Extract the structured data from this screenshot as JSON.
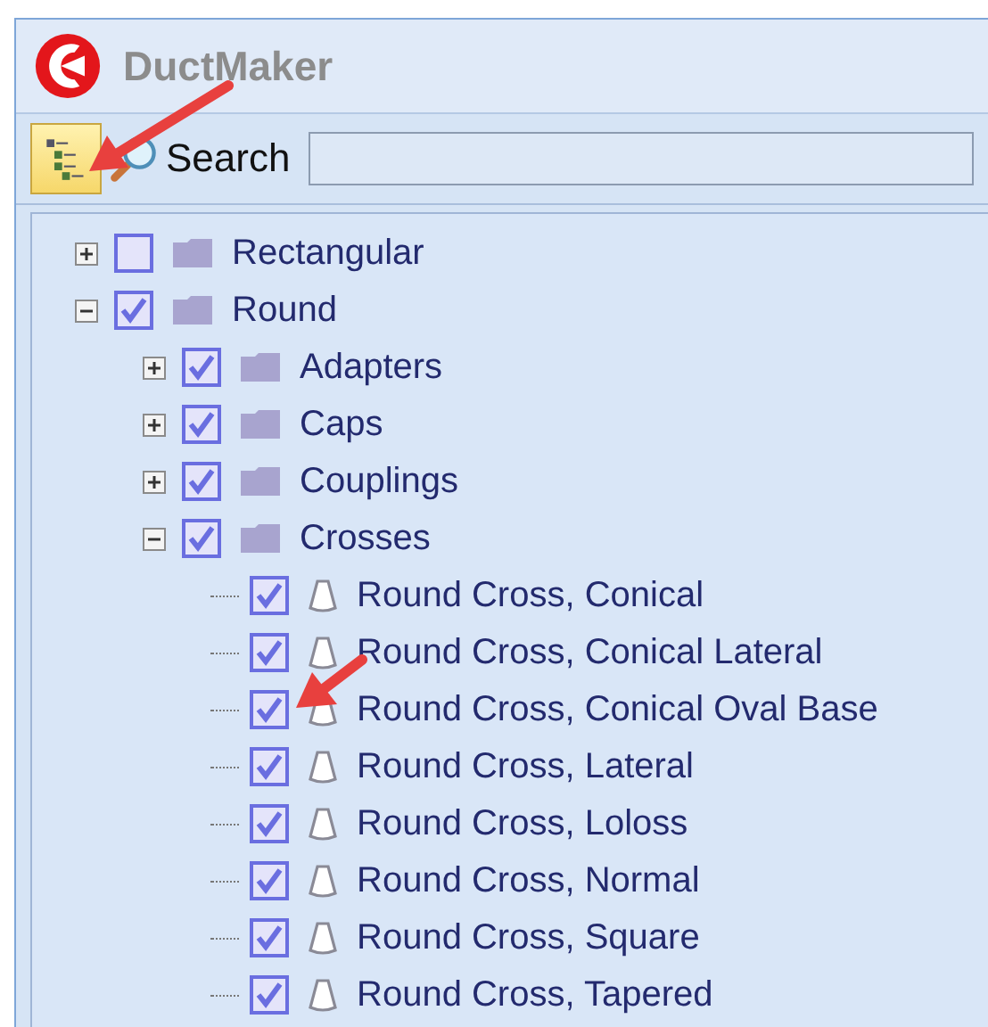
{
  "window": {
    "title": "DuctMaker"
  },
  "toolbar": {
    "tree_view_button": {
      "on": true
    },
    "search_label": "Search"
  },
  "tree": [
    {
      "label": "Rectangular",
      "kind": "folder",
      "checked": false,
      "expanded": false
    },
    {
      "label": "Round",
      "kind": "folder",
      "checked": true,
      "expanded": true,
      "children": [
        {
          "label": "Adapters",
          "kind": "folder",
          "checked": true,
          "expanded": false
        },
        {
          "label": "Caps",
          "kind": "folder",
          "checked": true,
          "expanded": false
        },
        {
          "label": "Couplings",
          "kind": "folder",
          "checked": true,
          "expanded": false
        },
        {
          "label": "Crosses",
          "kind": "folder",
          "checked": true,
          "expanded": true,
          "children": [
            {
              "label": "Round Cross, Conical",
              "kind": "part",
              "checked": true
            },
            {
              "label": "Round Cross, Conical Lateral",
              "kind": "part",
              "checked": true
            },
            {
              "label": "Round Cross, Conical Oval Base",
              "kind": "part",
              "checked": true
            },
            {
              "label": "Round Cross, Lateral",
              "kind": "part",
              "checked": true
            },
            {
              "label": "Round Cross, Loloss",
              "kind": "part",
              "checked": true
            },
            {
              "label": "Round Cross, Normal",
              "kind": "part",
              "checked": true
            },
            {
              "label": "Round Cross, Square",
              "kind": "part",
              "checked": true
            },
            {
              "label": "Round Cross, Tapered",
              "kind": "part",
              "checked": true
            }
          ]
        }
      ]
    }
  ]
}
